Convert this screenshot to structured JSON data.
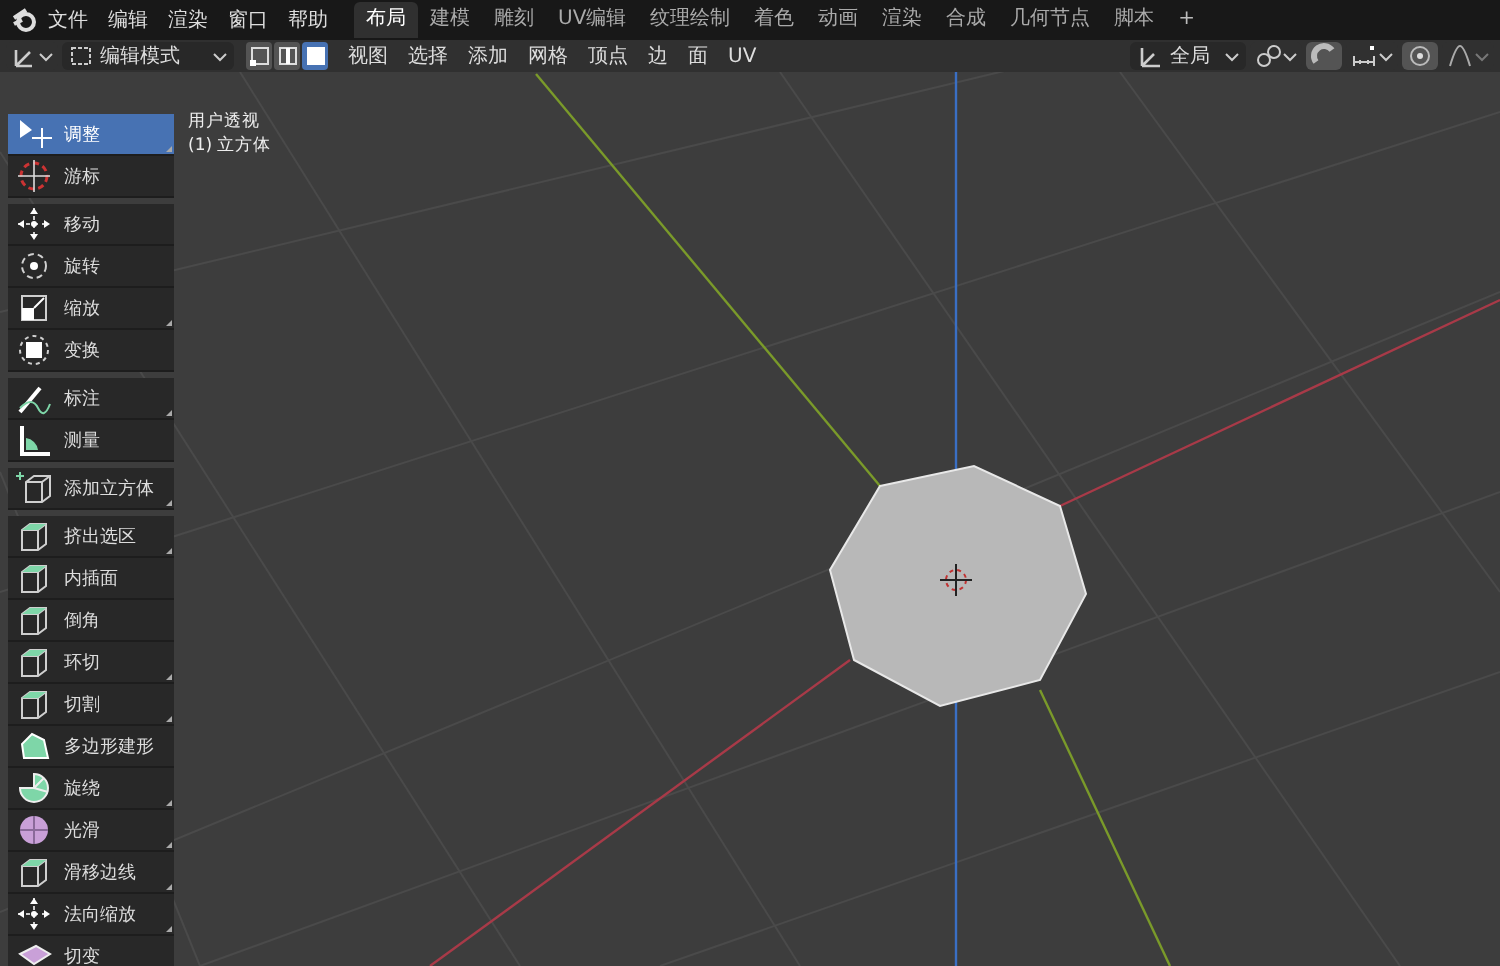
{
  "top_bar": {
    "menus": [
      "文件",
      "编辑",
      "渲染",
      "窗口",
      "帮助"
    ],
    "workspace_tabs": [
      {
        "label": "布局",
        "selected": true
      },
      {
        "label": "建模",
        "selected": false
      },
      {
        "label": "雕刻",
        "selected": false
      },
      {
        "label": "UV编辑",
        "selected": false
      },
      {
        "label": "纹理绘制",
        "selected": false
      },
      {
        "label": "着色",
        "selected": false
      },
      {
        "label": "动画",
        "selected": false
      },
      {
        "label": "渲染",
        "selected": false
      },
      {
        "label": "合成",
        "selected": false
      },
      {
        "label": "几何节点",
        "selected": false
      },
      {
        "label": "脚本",
        "selected": false
      }
    ],
    "add_tab": "+"
  },
  "header": {
    "mode": "编辑模式",
    "select_modes": [
      {
        "kind": "vertex",
        "selected": false
      },
      {
        "kind": "edge",
        "selected": false
      },
      {
        "kind": "face",
        "selected": true
      }
    ],
    "menus": [
      "视图",
      "选择",
      "添加",
      "网格",
      "顶点",
      "边",
      "面",
      "UV"
    ],
    "orientation": "全局"
  },
  "viewport": {
    "view_name": "用户透视",
    "object_name": "(1) 立方体"
  },
  "toolbar": [
    [
      {
        "label": "调整",
        "kind": "select",
        "selected": true,
        "more": true
      },
      {
        "label": "游标",
        "kind": "cursor",
        "selected": false,
        "more": false
      }
    ],
    [
      {
        "label": "移动",
        "kind": "move",
        "selected": false,
        "more": false
      },
      {
        "label": "旋转",
        "kind": "rotate",
        "selected": false,
        "more": false
      },
      {
        "label": "缩放",
        "kind": "scale",
        "selected": false,
        "more": true
      },
      {
        "label": "变换",
        "kind": "transform",
        "selected": false,
        "more": false
      }
    ],
    [
      {
        "label": "标注",
        "kind": "annotate",
        "selected": false,
        "more": true
      },
      {
        "label": "测量",
        "kind": "measure",
        "selected": false,
        "more": false
      }
    ],
    [
      {
        "label": "添加立方体",
        "kind": "cubeadd",
        "selected": false,
        "more": true
      }
    ],
    [
      {
        "label": "挤出选区",
        "kind": "cube",
        "selected": false,
        "more": true
      },
      {
        "label": "内插面",
        "kind": "cube",
        "selected": false,
        "more": false
      },
      {
        "label": "倒角",
        "kind": "cube",
        "selected": false,
        "more": false
      },
      {
        "label": "环切",
        "kind": "cube",
        "selected": false,
        "more": true
      },
      {
        "label": "切割",
        "kind": "cube",
        "selected": false,
        "more": true
      },
      {
        "label": "多边形建形",
        "kind": "blob",
        "selected": false,
        "more": false
      },
      {
        "label": "旋绕",
        "kind": "spin",
        "selected": false,
        "more": true
      },
      {
        "label": "光滑",
        "kind": "sphere",
        "selected": false,
        "more": true
      },
      {
        "label": "滑移边线",
        "kind": "cube",
        "selected": false,
        "more": true
      },
      {
        "label": "法向缩放",
        "kind": "move",
        "selected": false,
        "more": true
      },
      {
        "label": "切变",
        "kind": "shear",
        "selected": false,
        "more": false
      }
    ]
  ]
}
